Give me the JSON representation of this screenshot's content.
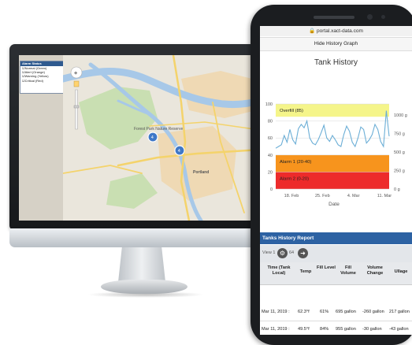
{
  "alarm_status": {
    "title": "Alarm Status",
    "items": [
      "Normal (Green)",
      "Alert (Orange)",
      "Warning (Yellow)",
      "Critical (Red)"
    ]
  },
  "map": {
    "city_label": "Portland",
    "park_label": "Forest Park Nature Reserve",
    "marker_counts": [
      "4",
      "4"
    ]
  },
  "phone": {
    "url": "portal.xact-data.com",
    "hide_history_button": "Hide History Graph",
    "report_header": "Tanks History Report",
    "view_label": "View 1",
    "page_hint": "64"
  },
  "chart_data": {
    "type": "line",
    "title": "Tank History",
    "xlabel": "Date",
    "x_ticks": [
      "18. Feb",
      "25. Feb",
      "4. Mar",
      "11. Mar"
    ],
    "y_ticks": [
      "0",
      "20",
      "40",
      "60",
      "80",
      "100"
    ],
    "y2_ticks": [
      "0 g",
      "250 g",
      "500 g",
      "750 g",
      "1000 g"
    ],
    "ylim": [
      0,
      100
    ],
    "bands": [
      {
        "label": "Overfill (85)",
        "from": 85,
        "to": 100,
        "color": "#f5f58a"
      },
      {
        "label": "Alarm 1 (20-40)",
        "from": 20,
        "to": 40,
        "color": "#f7941d"
      },
      {
        "label": "Alarm 2 (0-20)",
        "from": 0,
        "to": 20,
        "color": "#ed2b2b"
      }
    ],
    "series": [
      {
        "color": "#6baed6",
        "x": [
          0,
          1,
          2,
          3,
          4,
          5,
          6,
          7,
          8,
          9,
          10,
          11,
          12,
          13,
          14,
          15,
          16,
          17,
          18,
          19,
          20,
          21,
          22,
          23,
          24,
          25,
          26,
          27,
          28,
          29,
          30,
          31,
          32,
          33,
          34,
          35,
          36,
          37,
          38,
          39,
          40
        ],
        "values": [
          48,
          50,
          52,
          63,
          55,
          70,
          58,
          53,
          71,
          76,
          72,
          80,
          60,
          54,
          52,
          58,
          66,
          75,
          60,
          56,
          63,
          58,
          52,
          50,
          64,
          74,
          68,
          55,
          50,
          60,
          73,
          70,
          54,
          58,
          64,
          76,
          70,
          56,
          50,
          92,
          62
        ]
      }
    ]
  },
  "report": {
    "headers": [
      "Time (Tank Local)",
      "Temp",
      "Fill Level",
      "Fill Volume",
      "Volume Change",
      "Ullage"
    ],
    "rows": [
      [
        "Mar 11, 2019 :",
        "62.3°f",
        "61%",
        "695 gallon",
        "-260 gallon",
        "217 gallon"
      ],
      [
        "Mar 11, 2019 :",
        "49.5°f",
        "84%",
        "955 gallon",
        "-30 gallon",
        "-43 gallon"
      ]
    ]
  }
}
